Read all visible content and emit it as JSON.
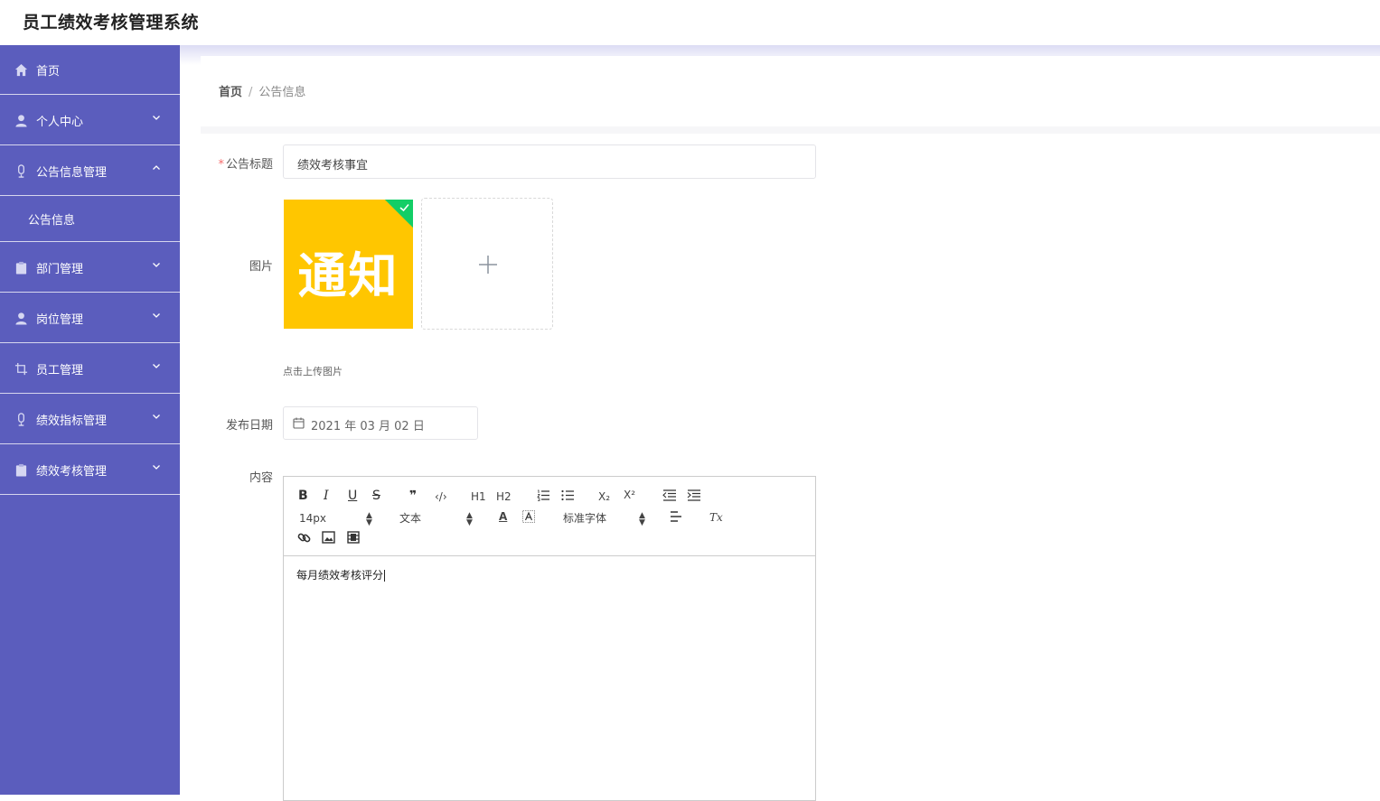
{
  "app": {
    "title": "员工绩效考核管理系统"
  },
  "sidebar": {
    "items": [
      {
        "label": "首页",
        "icon": "home-icon"
      },
      {
        "label": "个人中心",
        "icon": "user-icon"
      },
      {
        "label": "公告信息管理",
        "icon": "microphone-icon",
        "expanded": true,
        "children": [
          {
            "label": "公告信息"
          }
        ]
      },
      {
        "label": "部门管理",
        "icon": "clipboard-icon"
      },
      {
        "label": "岗位管理",
        "icon": "user-icon"
      },
      {
        "label": "员工管理",
        "icon": "crop-icon"
      },
      {
        "label": "绩效指标管理",
        "icon": "microphone-icon"
      },
      {
        "label": "绩效考核管理",
        "icon": "clipboard-icon"
      }
    ]
  },
  "breadcrumb": {
    "home": "首页",
    "separator": "/",
    "current": "公告信息"
  },
  "form": {
    "title_label": "公告标题",
    "title_required_mark": "*",
    "title_value": "绩效考核事宜",
    "image_label": "图片",
    "image_thumb_text": "通知",
    "upload_hint": "点击上传图片",
    "date_label": "发布日期",
    "date_value": "2021 年 03 月 02 日",
    "content_label": "内容"
  },
  "editor": {
    "toolbar": {
      "bold": "B",
      "italic": "I",
      "underline": "U",
      "strike": "S",
      "blockquote": "❞",
      "code": "‹/›",
      "h1": "H1",
      "h2": "H2",
      "sub": "X₂",
      "sup": "X²",
      "size_value": "14px",
      "header_value": "文本",
      "font_value": "标准字体",
      "color": "A",
      "clean": "Tx"
    },
    "content": "每月绩效考核评分"
  },
  "colors": {
    "sidebar_bg": "#5b5dbd",
    "accent_green": "#13ce66",
    "thumb_yellow": "#ffc600",
    "required": "#f56c6c"
  }
}
